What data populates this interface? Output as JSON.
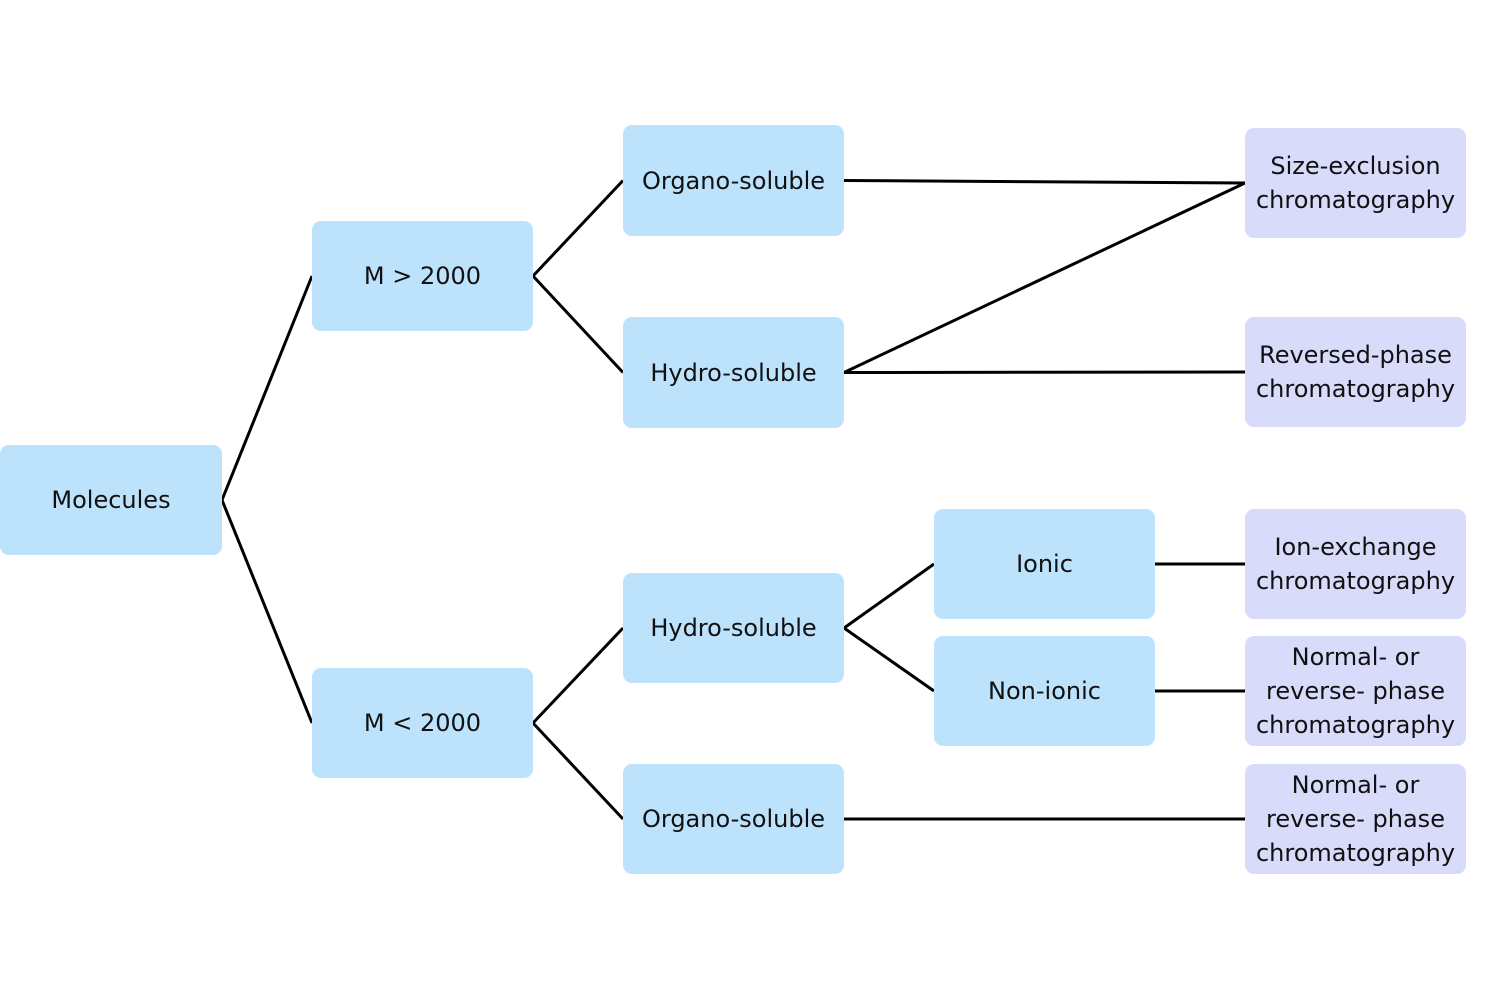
{
  "colors": {
    "category_node": "#bde3fc",
    "method_node": "#d9dbfb",
    "edge": "#000000"
  },
  "nodes": {
    "molecules": "Molecules",
    "m_gt": "M > 2000",
    "m_lt": "M < 2000",
    "organo_top": "Organo-soluble",
    "hydro_top": "Hydro-soluble",
    "hydro_bottom": "Hydro-soluble",
    "organo_bottom": "Organo-soluble",
    "ionic": "Ionic",
    "non_ionic": "Non-ionic",
    "sec": "Size-exclusion\nchromatography",
    "rp": "Reversed-phase\nchromatography",
    "iex": "Ion-exchange\nchromatography",
    "np1": "Normal- or\nreverse- phase\nchromatography",
    "np2": "Normal- or\nreverse- phase\nchromatography"
  },
  "edges": [
    [
      "molecules",
      "m_gt"
    ],
    [
      "molecules",
      "m_lt"
    ],
    [
      "m_gt",
      "organo_top"
    ],
    [
      "m_gt",
      "hydro_top"
    ],
    [
      "m_lt",
      "hydro_bottom"
    ],
    [
      "m_lt",
      "organo_bottom"
    ],
    [
      "organo_top",
      "sec"
    ],
    [
      "hydro_top",
      "sec"
    ],
    [
      "hydro_top",
      "rp"
    ],
    [
      "hydro_bottom",
      "ionic"
    ],
    [
      "hydro_bottom",
      "non_ionic"
    ],
    [
      "ionic",
      "iex"
    ],
    [
      "non_ionic",
      "np1"
    ],
    [
      "organo_bottom",
      "np2"
    ]
  ]
}
